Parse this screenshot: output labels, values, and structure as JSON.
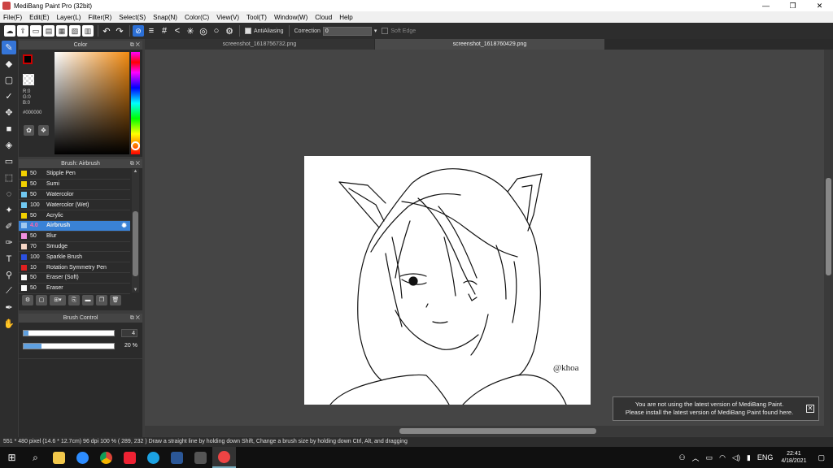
{
  "window": {
    "title": "MediBang Paint Pro (32bit)",
    "minimize": "—",
    "maximize": "❐",
    "close": "✕"
  },
  "menu": [
    "File(F)",
    "Edit(E)",
    "Layer(L)",
    "Filter(R)",
    "Select(S)",
    "Snap(N)",
    "Color(C)",
    "View(V)",
    "Tool(T)",
    "Window(W)",
    "Cloud",
    "Help"
  ],
  "toolbar": {
    "antialiasing_label": "AntiAliasing",
    "correction_label": "Correction",
    "correction_value": "0",
    "soft_edge_label": "Soft Edge"
  },
  "color_panel": {
    "title": "Color",
    "r": "R:0",
    "g": "G:0",
    "b": "B:0",
    "hex": "#000000"
  },
  "brush_panel": {
    "title": "Brush: Airbrush",
    "items": [
      {
        "size": "50",
        "name": "Stipple Pen",
        "color": "#f2d100"
      },
      {
        "size": "50",
        "name": "Sumi",
        "color": "#f2d100"
      },
      {
        "size": "50",
        "name": "Watercolor",
        "color": "#6fc7f0"
      },
      {
        "size": "100",
        "name": "Watercolor (Wet)",
        "color": "#6fc7f0"
      },
      {
        "size": "50",
        "name": "Acrylic",
        "color": "#f2d100"
      },
      {
        "size": "4.0",
        "name": "Airbrush",
        "color": "#a0c8f0"
      },
      {
        "size": "50",
        "name": "Blur",
        "color": "#f090e0"
      },
      {
        "size": "70",
        "name": "Smudge",
        "color": "#f5d5c5"
      },
      {
        "size": "100",
        "name": "Sparkle Brush",
        "color": "#2b50e0"
      },
      {
        "size": "10",
        "name": "Rotation Symmetry Pen",
        "color": "#e02020"
      },
      {
        "size": "50",
        "name": "Eraser (Soft)",
        "color": "#ffffff"
      },
      {
        "size": "50",
        "name": "Eraser",
        "color": "#ffffff"
      }
    ]
  },
  "brush_control": {
    "title": "Brush Control",
    "size_value": "4",
    "size_fraction": 0.05,
    "opacity_value": "20 %",
    "opacity_fraction": 0.2
  },
  "tabs": [
    "screenshot_1618756732.png",
    "screenshot_1618760429.png"
  ],
  "artwork": {
    "signature": "@khoa"
  },
  "notice": {
    "line1": "You are not using the latest version of MediBang Paint.",
    "line2": "Please install the latest version of MediBang Paint found here.",
    "close": "✕"
  },
  "status": "551 * 480 pixel  (14.6 * 12.7cm)  96 dpi  100 %  ( 289, 232 )  Draw a straight line by holding down Shift, Change a brush size by holding down Ctrl, Alt, and dragging",
  "taskbar": {
    "lang": "ENG",
    "time": "22:41",
    "date": "4/18/2021"
  }
}
